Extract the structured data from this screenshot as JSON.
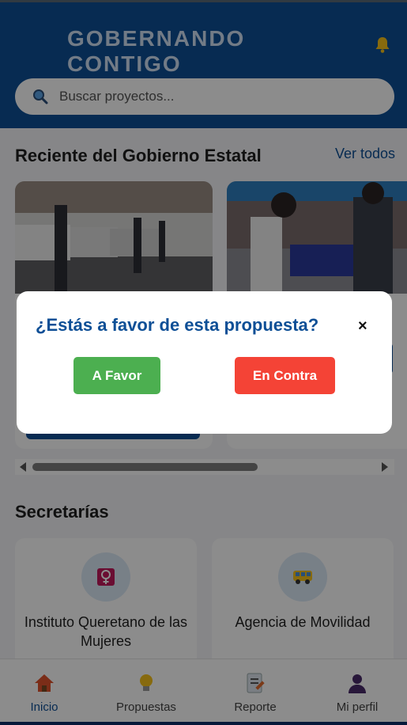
{
  "header": {
    "logo_text": "GOBERNANDO CONTIGO",
    "bell_icon": "bell-icon",
    "accent_color": "#0e4f96"
  },
  "search": {
    "placeholder": "Buscar proyectos...",
    "icon": "search-icon"
  },
  "recent": {
    "title": "Reciente del Gobierno Estatal",
    "view_all": "Ver todos"
  },
  "secretarias": {
    "title": "Secretarías",
    "items": [
      {
        "label": "Instituto Queretano de las Mujeres",
        "icon": "female-symbol-icon"
      },
      {
        "label": "Agencia de Movilidad",
        "icon": "bus-icon"
      }
    ]
  },
  "nav": {
    "items": [
      {
        "label": "Inicio",
        "icon": "home-icon"
      },
      {
        "label": "Propuestas",
        "icon": "lightbulb-icon"
      },
      {
        "label": "Reporte",
        "icon": "report-icon"
      },
      {
        "label": "Mi perfil",
        "icon": "user-icon"
      }
    ]
  },
  "modal": {
    "question": "¿Estás a favor de esta propuesta?",
    "close": "×",
    "favor_label": "A Favor",
    "contra_label": "En Contra",
    "favor_color": "#4caf50",
    "contra_color": "#f44336"
  }
}
